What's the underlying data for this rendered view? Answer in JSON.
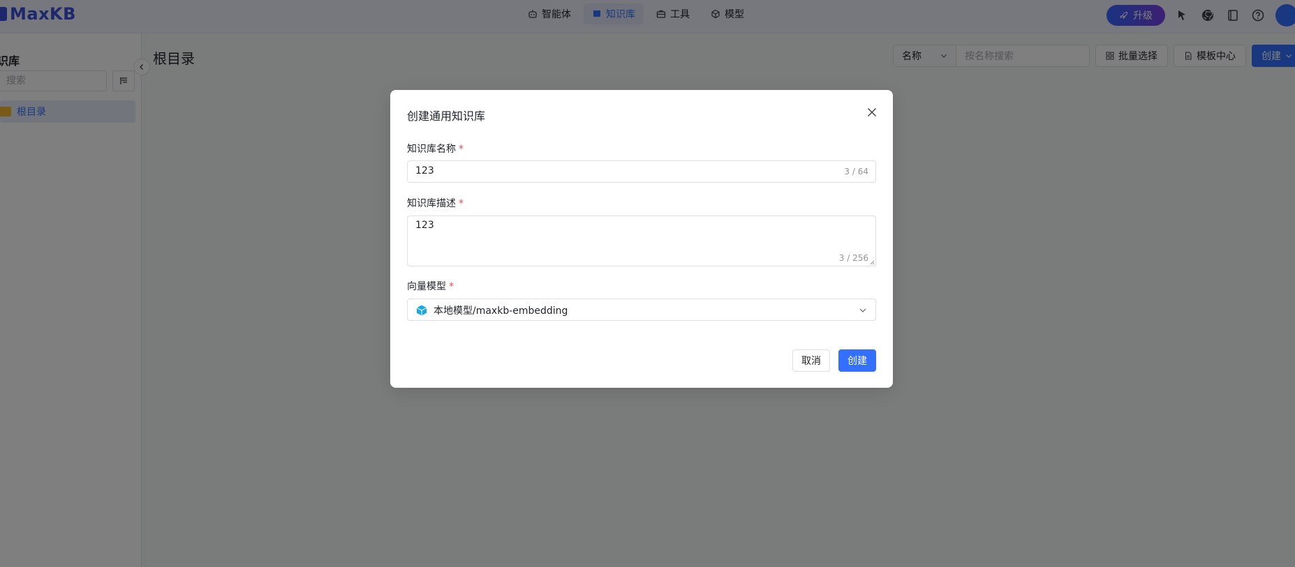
{
  "app": {
    "logo_text": "MaxKB"
  },
  "topnav": {
    "items": [
      {
        "label": "智能体",
        "icon": "robot-icon",
        "active": false
      },
      {
        "label": "知识库",
        "icon": "book-icon",
        "active": true
      },
      {
        "label": "工具",
        "icon": "toolbox-icon",
        "active": false
      },
      {
        "label": "模型",
        "icon": "cube-icon",
        "active": false
      }
    ],
    "upgrade_label": "升级",
    "right_icons": [
      "pointer-icon",
      "github-icon",
      "docs-icon",
      "help-icon",
      "avatar"
    ]
  },
  "sidebar": {
    "title": "识库",
    "search_placeholder": "搜索",
    "tree": [
      {
        "label": "根目录",
        "icon": "folder-icon",
        "selected": true
      }
    ]
  },
  "main": {
    "title": "根目录",
    "filter_select": "名称",
    "filter_placeholder": "按名称搜索",
    "batch_select_label": "批量选择",
    "template_center_label": "模板中心",
    "create_label": "创建"
  },
  "dialog": {
    "title": "创建通用知识库",
    "name_label": "知识库名称",
    "name_value": "123",
    "name_counter": "3 / 64",
    "desc_label": "知识库描述",
    "desc_value": "123",
    "desc_counter": "3 / 256",
    "model_label": "向量模型",
    "model_value": "本地模型/maxkb-embedding",
    "cancel_label": "取消",
    "create_label": "创建"
  },
  "colors": {
    "primary": "#3370ff",
    "required": "#f54a45",
    "folder": "#f3b72c",
    "brand": "#3d4fd8"
  }
}
